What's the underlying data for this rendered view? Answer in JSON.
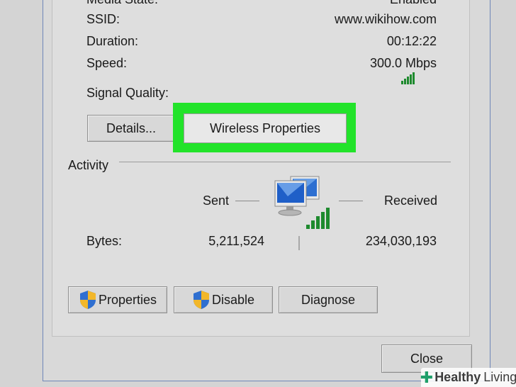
{
  "status": {
    "media_state_label": "Media State:",
    "media_state_value": "Enabled",
    "ssid_label": "SSID:",
    "ssid_value": "www.wikihow.com",
    "duration_label": "Duration:",
    "duration_value": "00:12:22",
    "speed_label": "Speed:",
    "speed_value": "300.0 Mbps",
    "signal_quality_label": "Signal Quality:",
    "signal_bars_level": 5,
    "signal_bars_max": 5
  },
  "buttons": {
    "details": "Details...",
    "wireless_properties": "Wireless Properties",
    "properties": "Properties",
    "disable": "Disable",
    "diagnose": "Diagnose",
    "close": "Close"
  },
  "activity": {
    "section_title": "Activity",
    "sent_label": "Sent",
    "received_label": "Received",
    "bytes_label": "Bytes:",
    "bytes_sent": "5,211,524",
    "bytes_received": "234,030,193"
  },
  "colors": {
    "highlight": "#22e32a",
    "signal_green": "#1e8a2e",
    "shield_blue": "#2f6fd0",
    "shield_yellow": "#f2b72a"
  },
  "watermark": {
    "brand": "Healthy",
    "brand_suffix": "Living"
  }
}
